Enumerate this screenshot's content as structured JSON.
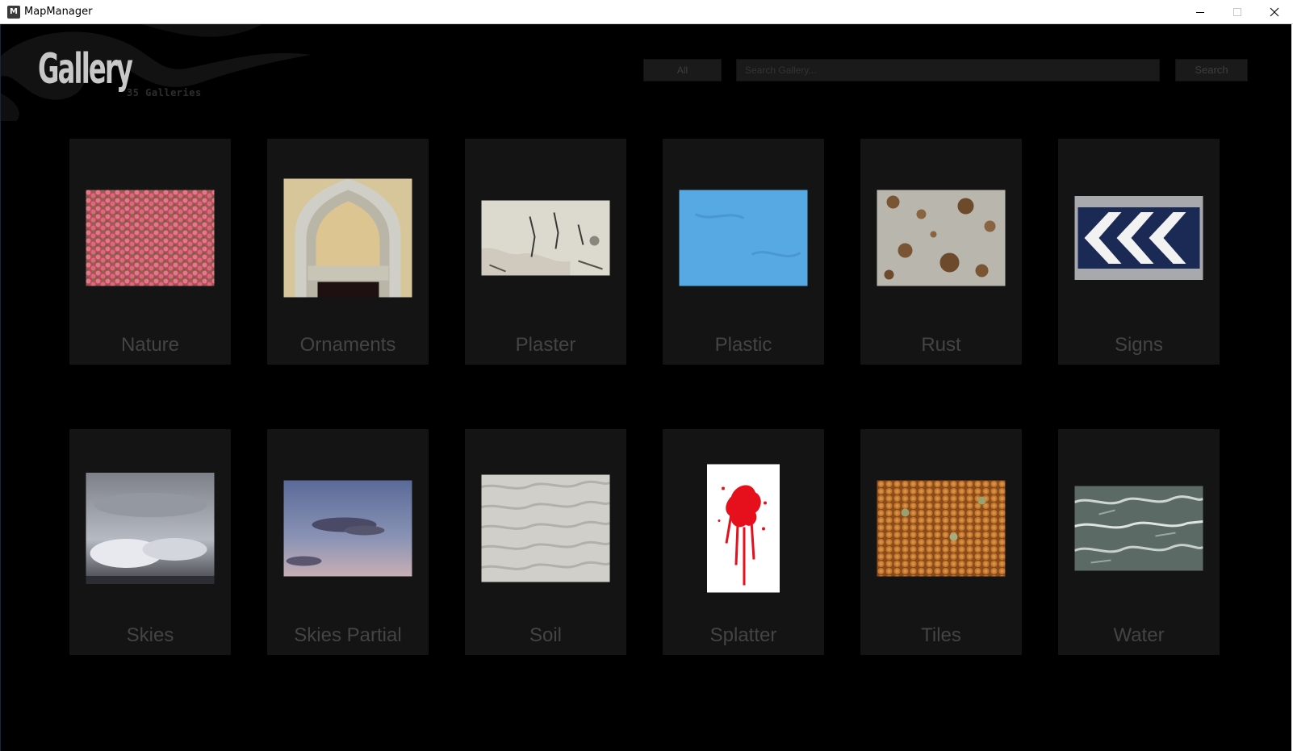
{
  "window": {
    "title": "MapManager",
    "app_icon_glyph": "M",
    "controls": [
      "minimize-icon",
      "maximize-icon",
      "close-icon"
    ]
  },
  "header": {
    "logo_text": "Gallery",
    "gallery_count": "35 Galleries"
  },
  "search": {
    "filter_label": "All",
    "placeholder": "Search Gallery...",
    "button_label": "Search"
  },
  "galleries": [
    {
      "label": "Nature",
      "image": "pink-flowers"
    },
    {
      "label": "Ornaments",
      "image": "gothic-arch"
    },
    {
      "label": "Plaster",
      "image": "plaster-wall"
    },
    {
      "label": "Plastic",
      "image": "blue-plastic"
    },
    {
      "label": "Rust",
      "image": "rusted-metal"
    },
    {
      "label": "Signs",
      "image": "chevron-sign"
    },
    {
      "label": "Skies",
      "image": "cloudy-sky"
    },
    {
      "label": "Skies Partial",
      "image": "dusk-sky"
    },
    {
      "label": "Soil",
      "image": "sand-ripples"
    },
    {
      "label": "Splatter",
      "image": "red-splatter"
    },
    {
      "label": "Tiles",
      "image": "hex-tiles"
    },
    {
      "label": "Water",
      "image": "ocean-waves"
    }
  ],
  "colors": {
    "background": "#000000",
    "card": "#141414",
    "label_text": "#444444"
  }
}
